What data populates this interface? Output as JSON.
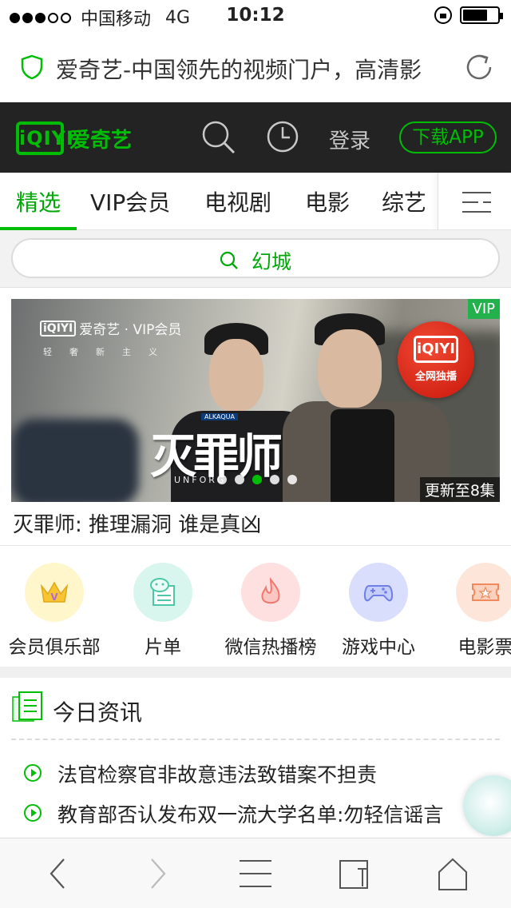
{
  "status_bar": {
    "carrier": "中国移动",
    "network": "4G",
    "time": "10:12",
    "signal_bars": 3,
    "signal_total": 5
  },
  "url_bar": {
    "page_title": "爱奇艺-中国领先的视频门户，高清影",
    "icons": {
      "secure": "shield-icon",
      "reload": "reload-icon"
    },
    "accent": "#00be06"
  },
  "header": {
    "logo_mark": "iQIYI",
    "logo_text": "爱奇艺",
    "login": "登录",
    "download": "下载APP",
    "icons": {
      "search": "search-icon",
      "history": "clock-icon"
    }
  },
  "tabs": {
    "items": [
      "精选",
      "VIP会员",
      "电视剧",
      "电影",
      "综艺"
    ],
    "active": "精选",
    "more_icon": "menu-icon"
  },
  "search": {
    "query": "幻城"
  },
  "banner": {
    "brand_mark": "iQIYI",
    "brand": "爱奇艺 · VIP会员",
    "brand_sub": "轻奢新主义",
    "show_title": "灭罪师",
    "sponsor_tag": "ALKAQUA",
    "english_title": "UNFORG",
    "vip_badge": "VIP",
    "exclusive_mark": "iQIYI",
    "exclusive": "全网独播",
    "update_info": "更新至8集",
    "carousel_count": 5,
    "carousel_active": 2,
    "caption": "灭罪师: 推理漏洞 谁是真凶"
  },
  "shortcuts": [
    {
      "label": "会员俱乐部",
      "icon": "crown-icon"
    },
    {
      "label": "片单",
      "icon": "list-chat-icon"
    },
    {
      "label": "微信热播榜",
      "icon": "flame-icon"
    },
    {
      "label": "游戏中心",
      "icon": "gamepad-icon"
    },
    {
      "label": "电影票",
      "icon": "ticket-icon"
    }
  ],
  "news": {
    "heading": "今日资讯",
    "items": [
      "法官检察官非故意违法致错案不担责",
      "教育部否认发布双一流大学名单:勿轻信谣言"
    ]
  },
  "toolbar": {
    "icons": [
      "back-icon",
      "forward-icon",
      "menu-icon",
      "tabs-icon",
      "home-icon"
    ]
  }
}
